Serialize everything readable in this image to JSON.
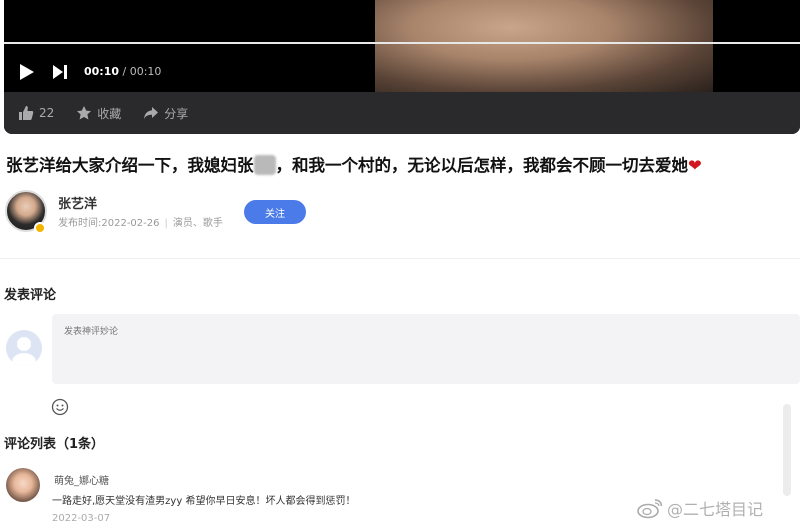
{
  "player": {
    "current_time": "00:10",
    "separator": " / ",
    "total_time": "00:10",
    "actions": {
      "like_count": "22",
      "favorite_label": "收藏",
      "share_label": "分享"
    }
  },
  "article": {
    "title_part1": "张艺洋给大家介绍一下，我媳妇张",
    "title_part2": "和我一个村的，无论以后怎样，我都会不顾一切去爱她",
    "heart": "❤"
  },
  "author": {
    "name": "张艺洋",
    "publish_time": "发布时间:2022-02-26",
    "tags": "演员、歌手",
    "follow_label": "关注"
  },
  "comment_form": {
    "heading": "发表评论",
    "placeholder": "发表神评妙论"
  },
  "comment_list": {
    "heading": "评论列表（1条）",
    "items": [
      {
        "user": "萌兔_娜心糖",
        "text": "一路走好,愿天堂没有渣男zyy 希望你早日安息！坏人都会得到惩罚！",
        "date": "2022-03-07"
      }
    ]
  },
  "watermark": {
    "text": "@二七塔目记"
  }
}
